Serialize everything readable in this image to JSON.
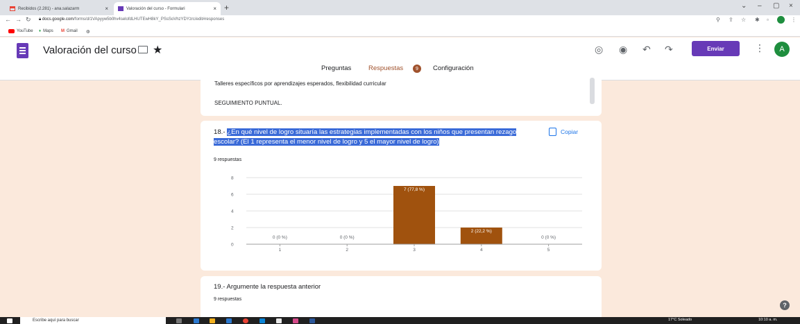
{
  "browser": {
    "tabs": [
      {
        "label": "Recibidos (2.281) - ana.salazarm",
        "favicon": "gmail-icon"
      },
      {
        "label": "Valoración del curso - Formulari",
        "favicon": "forms-icon"
      }
    ],
    "url_domain": "docs.google.com",
    "url_path": "/forms/d/1VApyyw5b0hv4selofdLHUTEwH8kY_PSsSoVhzYDYzrc/edit#responses",
    "bookmarks": [
      "YouTube",
      "Maps",
      "Gmail"
    ]
  },
  "app": {
    "title": "Valoración del curso",
    "send_label": "Enviar",
    "avatar_letter": "A",
    "accent": "#673ab7"
  },
  "tabs": {
    "questions": "Preguntas",
    "responses": "Respuestas",
    "responses_count": "9",
    "settings": "Configuración"
  },
  "prev_answer": {
    "line1": "Talleres específicos por aprendizajes esperados, flexibilidad curricular",
    "line2": "SEGUIMIENTO PUNTUAL."
  },
  "question": {
    "number": "18.- ",
    "text": "¿En qué nivel de logro situaría las estrategias implementadas con los niños que presentan rezago escolar? (El 1 representa el menor nivel de logro y 5 el mayor nivel de logro)",
    "responses": "9 respuestas",
    "copy_label": "Copiar"
  },
  "chart_data": {
    "type": "bar",
    "categories": [
      "1",
      "2",
      "3",
      "4",
      "5"
    ],
    "values": [
      0,
      0,
      7,
      2,
      0
    ],
    "data_labels": [
      "0 (0 %)",
      "0 (0 %)",
      "7 (77,8 %)",
      "2 (22,2 %)",
      "0 (0 %)"
    ],
    "yticks": [
      "0",
      "2",
      "4",
      "6",
      "8"
    ],
    "ylim": [
      0,
      8
    ],
    "bar_color": "#a0520e",
    "grid": true
  },
  "next_question": {
    "text": "19.- Argumente la respuesta anterior",
    "responses": "9 respuestas"
  },
  "taskbar": {
    "search_placeholder": "Escribe aquí para buscar",
    "weather": "17°C  Soleado",
    "time": "10:10 a. m."
  }
}
